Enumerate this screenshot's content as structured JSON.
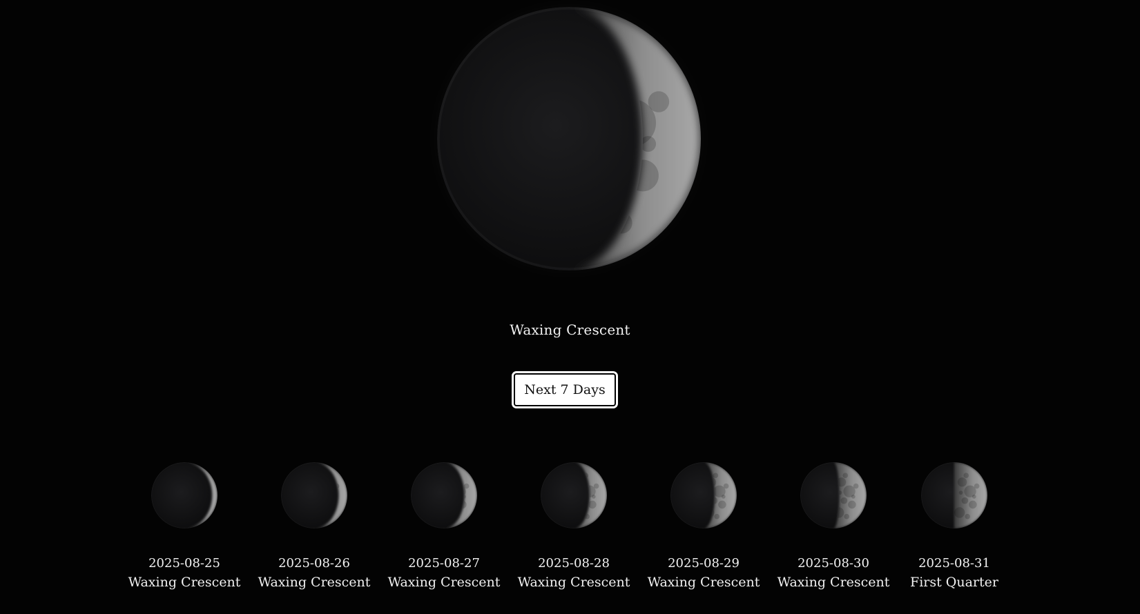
{
  "current": {
    "phase": "Waxing Crescent",
    "illumination": 0.22
  },
  "next_button": {
    "label": "Next 7 Days"
  },
  "forecast": [
    {
      "date": "2025-08-25",
      "phase": "Waxing Crescent",
      "illumination": 0.08
    },
    {
      "date": "2025-08-26",
      "phase": "Waxing Crescent",
      "illumination": 0.13
    },
    {
      "date": "2025-08-27",
      "phase": "Waxing Crescent",
      "illumination": 0.19
    },
    {
      "date": "2025-08-28",
      "phase": "Waxing Crescent",
      "illumination": 0.26
    },
    {
      "date": "2025-08-29",
      "phase": "Waxing Crescent",
      "illumination": 0.33
    },
    {
      "date": "2025-08-30",
      "phase": "Waxing Crescent",
      "illumination": 0.41
    },
    {
      "date": "2025-08-31",
      "phase": "First Quarter",
      "illumination": 0.5
    }
  ],
  "colors": {
    "background": "#030303",
    "text": "#f2f2f2",
    "button_bg": "#ffffff",
    "button_text": "#111111"
  }
}
